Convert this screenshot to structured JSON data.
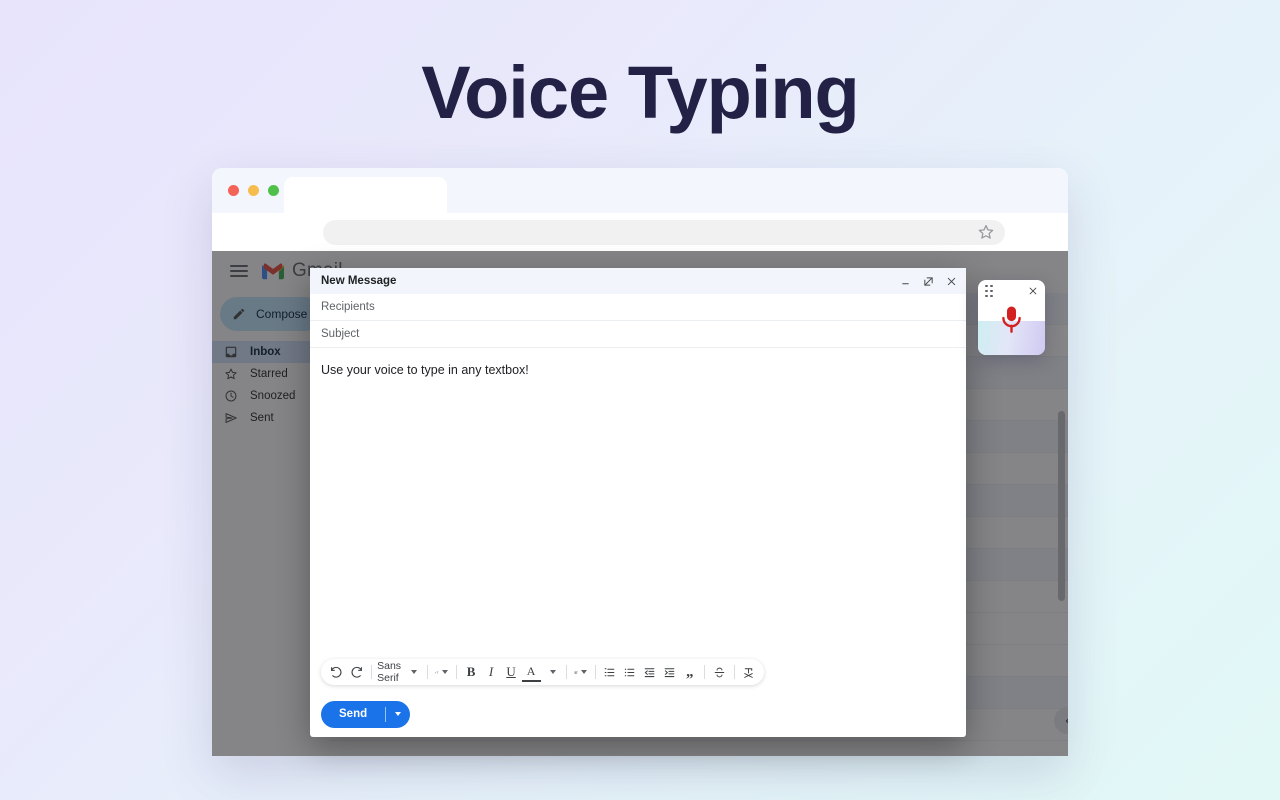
{
  "page": {
    "title": "Voice Typing",
    "background_from": "#e7e4fc",
    "background_to": "#e1f8f6",
    "title_color": "#232146"
  },
  "browser": {
    "traffic_lights": [
      "close-red",
      "minimize-yellow",
      "maximize-green"
    ],
    "tab_label": "",
    "address_value": "",
    "address_placeholder": "",
    "bookmark_icon": "star-icon"
  },
  "gmail": {
    "menu_icon": "hamburger-icon",
    "brand": "Gmail",
    "sidebar": {
      "compose_label": "Compose",
      "compose_icon": "pencil-icon",
      "items": [
        {
          "label": "Inbox",
          "icon": "inbox-icon",
          "active": true
        },
        {
          "label": "Starred",
          "icon": "star-icon",
          "active": false
        },
        {
          "label": "Snoozed",
          "icon": "clock-icon",
          "active": false
        },
        {
          "label": "Sent",
          "icon": "send-icon",
          "active": false
        }
      ]
    },
    "panel_toggle_icon": "chevron-left-icon",
    "mail_rows": [
      {
        "sender": "",
        "subject": "",
        "date": ""
      },
      {
        "sender": "",
        "subject": "",
        "date": ""
      },
      {
        "sender": "",
        "subject": "",
        "date": ""
      },
      {
        "sender": "",
        "subject": "",
        "date": ""
      },
      {
        "sender": "",
        "subject": "",
        "date": ""
      },
      {
        "sender": "",
        "subject": "",
        "date": ""
      },
      {
        "sender": "",
        "subject": "",
        "date": ""
      },
      {
        "sender": "",
        "subject": "",
        "date": ""
      },
      {
        "sender": "",
        "subject": "",
        "date": ""
      },
      {
        "sender": "",
        "subject": "",
        "date": ""
      },
      {
        "sender": "",
        "subject": "",
        "date": ""
      },
      {
        "sender": "",
        "subject": "",
        "date": ""
      },
      {
        "sender": "",
        "subject": "",
        "date": ""
      },
      {
        "sender": "",
        "subject": "",
        "date": ""
      }
    ]
  },
  "compose": {
    "title": "New Message",
    "window_actions": [
      {
        "name": "minimize-button",
        "glyph": "minimize-icon"
      },
      {
        "name": "expand-button",
        "glyph": "expand-icon"
      },
      {
        "name": "close-button",
        "glyph": "close-icon"
      }
    ],
    "recipients_placeholder": "Recipients",
    "recipients_value": "",
    "subject_placeholder": "Subject",
    "subject_value": "",
    "body_text": "Use your voice to type in any textbox!",
    "toolbar": {
      "undo": "undo-icon",
      "redo": "redo-icon",
      "font_family": "Sans Serif",
      "font_size": "text-size-icon",
      "bold": "B",
      "italic": "I",
      "underline": "U",
      "text_color": "A",
      "align": "align-icon",
      "numbered_list": "numbered-list-icon",
      "bulleted_list": "bulleted-list-icon",
      "indent_less": "indent-less-icon",
      "indent_more": "indent-more-icon",
      "quote": "quote-icon",
      "strikethrough": "strikethrough-icon",
      "remove_formatting": "remove-formatting-icon"
    },
    "send_label": "Send",
    "send_color": "#1a73e8",
    "send_options_icon": "chevron-down-icon"
  },
  "mic_widget": {
    "drag_handle_icon": "drag-handle-icon",
    "close_icon": "close-icon",
    "mic_icon": "microphone-icon",
    "mic_color": "#d32020",
    "gradient_from": "#cdeef2",
    "gradient_to": "#cfc9f2"
  }
}
